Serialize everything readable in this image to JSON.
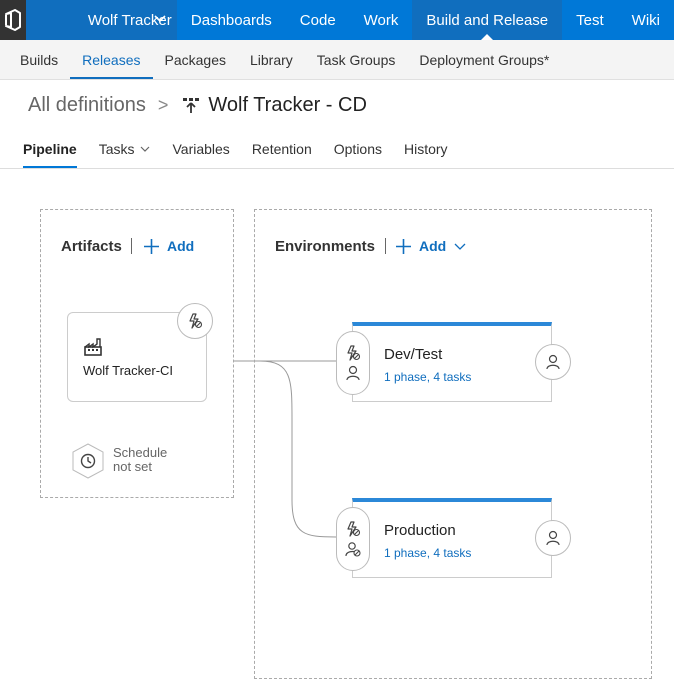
{
  "topbar": {
    "project_name": "Wolf Tracker",
    "nav": [
      "Dashboards",
      "Code",
      "Work",
      "Build and Release",
      "Test",
      "Wiki"
    ],
    "active_nav": "Build and Release"
  },
  "subnav": {
    "items": [
      "Builds",
      "Releases",
      "Packages",
      "Library",
      "Task Groups",
      "Deployment Groups*"
    ],
    "active": "Releases"
  },
  "breadcrumb": {
    "root": "All definitions",
    "separator": ">",
    "title": "Wolf Tracker - CD"
  },
  "tabs": {
    "items": [
      "Pipeline",
      "Tasks",
      "Variables",
      "Retention",
      "Options",
      "History"
    ],
    "active": "Pipeline"
  },
  "artifacts": {
    "title": "Artifacts",
    "add_label": "Add",
    "card_name": "Wolf Tracker-CI",
    "schedule_line1": "Schedule",
    "schedule_line2": "not set"
  },
  "environments": {
    "title": "Environments",
    "add_label": "Add",
    "items": [
      {
        "name": "Dev/Test",
        "summary": "1 phase, 4 tasks"
      },
      {
        "name": "Production",
        "summary": "1 phase, 4 tasks"
      }
    ]
  },
  "colors": {
    "brand_blue": "#0078d7",
    "dark_blue": "#106ebe",
    "env_top": "#2b88d8"
  }
}
